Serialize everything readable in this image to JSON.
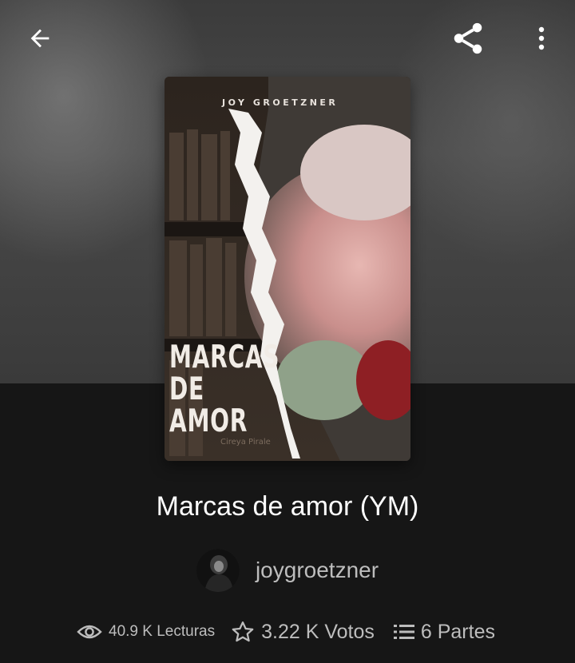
{
  "colors": {
    "background": "#161616",
    "hero": "#444444",
    "text_primary": "#ffffff",
    "text_secondary": "#bdbdbd"
  },
  "topbar": {
    "back_icon": "arrow-left-icon",
    "share_icon": "share-icon",
    "more_icon": "more-vertical-icon"
  },
  "cover": {
    "author_text": "JOY GROETZNER",
    "title_line1": "MARCAS",
    "title_line2": "DE AMOR"
  },
  "story": {
    "title": "Marcas de amor (YM)"
  },
  "author": {
    "username": "joygroetzner"
  },
  "stats": {
    "reads": {
      "icon": "eye-icon",
      "value": "40.9 K Lecturas"
    },
    "votes": {
      "icon": "star-outline-icon",
      "value": "3.22 K Votos"
    },
    "parts": {
      "icon": "list-icon",
      "value": "6 Partes"
    }
  }
}
